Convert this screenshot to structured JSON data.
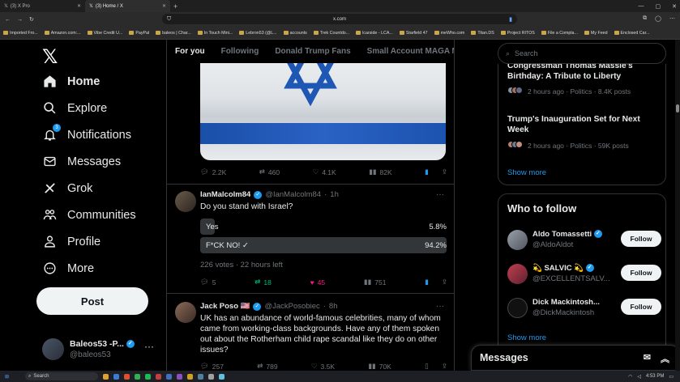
{
  "browser": {
    "tabs": [
      {
        "label": "(3) X Pro",
        "active": false
      },
      {
        "label": "(3) Home / X",
        "active": true
      }
    ],
    "url": "x.com",
    "bookmarks": [
      "Imported Fro...",
      "Amazon.com:...",
      "Vibe Credit U...",
      "PayPal",
      "baleos | Char...",
      "In Touch Mini...",
      "Lebron53 (@L...",
      "accounts",
      "Trek Countdo...",
      "lcarside - LCA...",
      "Starfield 47",
      "meWho.com",
      "Titan.DS",
      "Project RITOS",
      "File a Compla...",
      "My Feed",
      "Enclosed Car..."
    ]
  },
  "nav": {
    "items": [
      {
        "label": "Home",
        "icon": "home-icon"
      },
      {
        "label": "Explore",
        "icon": "search-icon"
      },
      {
        "label": "Notifications",
        "icon": "bell-icon",
        "badge": "3"
      },
      {
        "label": "Messages",
        "icon": "envelope-icon"
      },
      {
        "label": "Grok",
        "icon": "grok-icon"
      },
      {
        "label": "Communities",
        "icon": "communities-icon"
      },
      {
        "label": "Profile",
        "icon": "person-icon"
      },
      {
        "label": "More",
        "icon": "more-circle-icon"
      }
    ],
    "post_label": "Post",
    "account": {
      "name": "Baleos53 -P...",
      "handle": "@baleos53"
    }
  },
  "feed": {
    "tabs": [
      "For you",
      "Following",
      "Donald Trump Fans",
      "Small Account MAGA M"
    ],
    "tweet1_actions": {
      "replies": "2.2K",
      "reposts": "460",
      "likes": "4.1K",
      "views": "82K"
    },
    "tweet2": {
      "name": "IanMalcolm84",
      "handle": "@IanMalcolm84",
      "time": "1h",
      "text": "Do you stand with Israel?",
      "poll": [
        {
          "label": "Yes",
          "pct": "5.8%",
          "fill": 0.058
        },
        {
          "label": "F*CK NO! ✓",
          "pct": "94.2%",
          "fill": 0.942
        }
      ],
      "poll_meta": "226 votes · 22 hours left",
      "actions": {
        "replies": "5",
        "reposts": "18",
        "likes": "45",
        "views": "751"
      }
    },
    "tweet3": {
      "name": "Jack Poso 🇺🇸",
      "handle": "@JackPosobiec",
      "time": "8h",
      "text": "UK has an abundance of world-famous celebrities, many of whom came from working-class backgrounds. Have any of them spoken out about the Rotherham child rape scandal like they do on other issues?",
      "actions": {
        "replies": "257",
        "reposts": "789",
        "likes": "3.5K",
        "views": "70K"
      }
    }
  },
  "sidebar": {
    "search_placeholder": "Search",
    "trends": [
      {
        "title": "Congressman Thomas Massie's Birthday: A Tribute to Liberty",
        "meta": "2 hours ago · Politics · 8.4K posts"
      },
      {
        "title": "Trump's Inauguration Set for Next Week",
        "meta": "2 hours ago · Politics · 59K posts"
      }
    ],
    "show_more": "Show more",
    "who_to_follow_title": "Who to follow",
    "follow_suggestions": [
      {
        "name": "Aldo Tomassetti",
        "handle": "@AldoAldot",
        "button": "Follow"
      },
      {
        "name": "💫 SALVIC 💫",
        "handle": "@EXCELLENTSALV...",
        "button": "Follow"
      },
      {
        "name": "Dick Mackintosh...",
        "handle": "@DickMackintosh",
        "button": "Follow"
      }
    ],
    "show_more_2": "Show more",
    "messages_label": "Messages"
  },
  "taskbar": {
    "search": "Search",
    "time": "4:53 PM"
  },
  "colors": {
    "accent": "#1d9bf0",
    "like": "#f91880",
    "repost": "#00ba7c",
    "background": "#000000"
  }
}
